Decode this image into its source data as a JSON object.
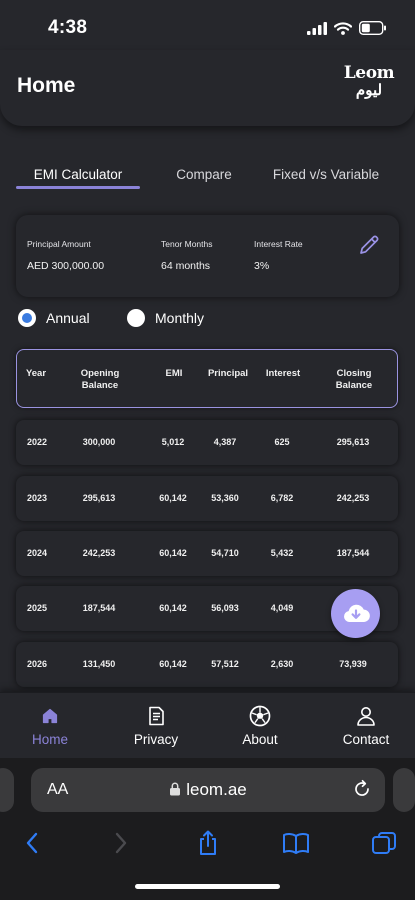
{
  "status": {
    "time": "4:38"
  },
  "header": {
    "title": "Home",
    "logo_latin": "Leom",
    "logo_arabic": "ليوم"
  },
  "tabs": [
    {
      "label": "EMI Calculator",
      "active": true
    },
    {
      "label": "Compare",
      "active": false
    },
    {
      "label": "Fixed v/s Variable",
      "active": false
    }
  ],
  "params": {
    "principal": {
      "label": "Principal Amount",
      "value": "AED 300,000.00"
    },
    "tenor": {
      "label": "Tenor Months",
      "value": "64 months"
    },
    "rate": {
      "label": "Interest Rate",
      "value": "3%"
    }
  },
  "mode": {
    "annual": "Annual",
    "monthly": "Monthly",
    "selected": "annual"
  },
  "table": {
    "headers": [
      "Year",
      "Opening Balance",
      "EMI",
      "Principal",
      "Interest",
      "Closing Balance"
    ],
    "rows": [
      [
        "2022",
        "300,000",
        "5,012",
        "4,387",
        "625",
        "295,613"
      ],
      [
        "2023",
        "295,613",
        "60,142",
        "53,360",
        "6,782",
        "242,253"
      ],
      [
        "2024",
        "242,253",
        "60,142",
        "54,710",
        "5,432",
        "187,544"
      ],
      [
        "2025",
        "187,544",
        "60,142",
        "56,093",
        "4,049",
        ""
      ],
      [
        "2026",
        "131,450",
        "60,142",
        "57,512",
        "2,630",
        "73,939"
      ]
    ]
  },
  "nav": [
    {
      "label": "Home",
      "icon": "home-icon",
      "active": true
    },
    {
      "label": "Privacy",
      "icon": "document-icon",
      "active": false
    },
    {
      "label": "About",
      "icon": "football-icon",
      "active": false
    },
    {
      "label": "Contact",
      "icon": "person-icon",
      "active": false
    }
  ],
  "browser": {
    "text_size": "AA",
    "url": "leom.ae"
  },
  "colors": {
    "accent": "#8b83d8",
    "fab": "#a79ef2",
    "radio": "#3a7be0",
    "ios_blue": "#2f7cf6",
    "background": "#26272c"
  }
}
